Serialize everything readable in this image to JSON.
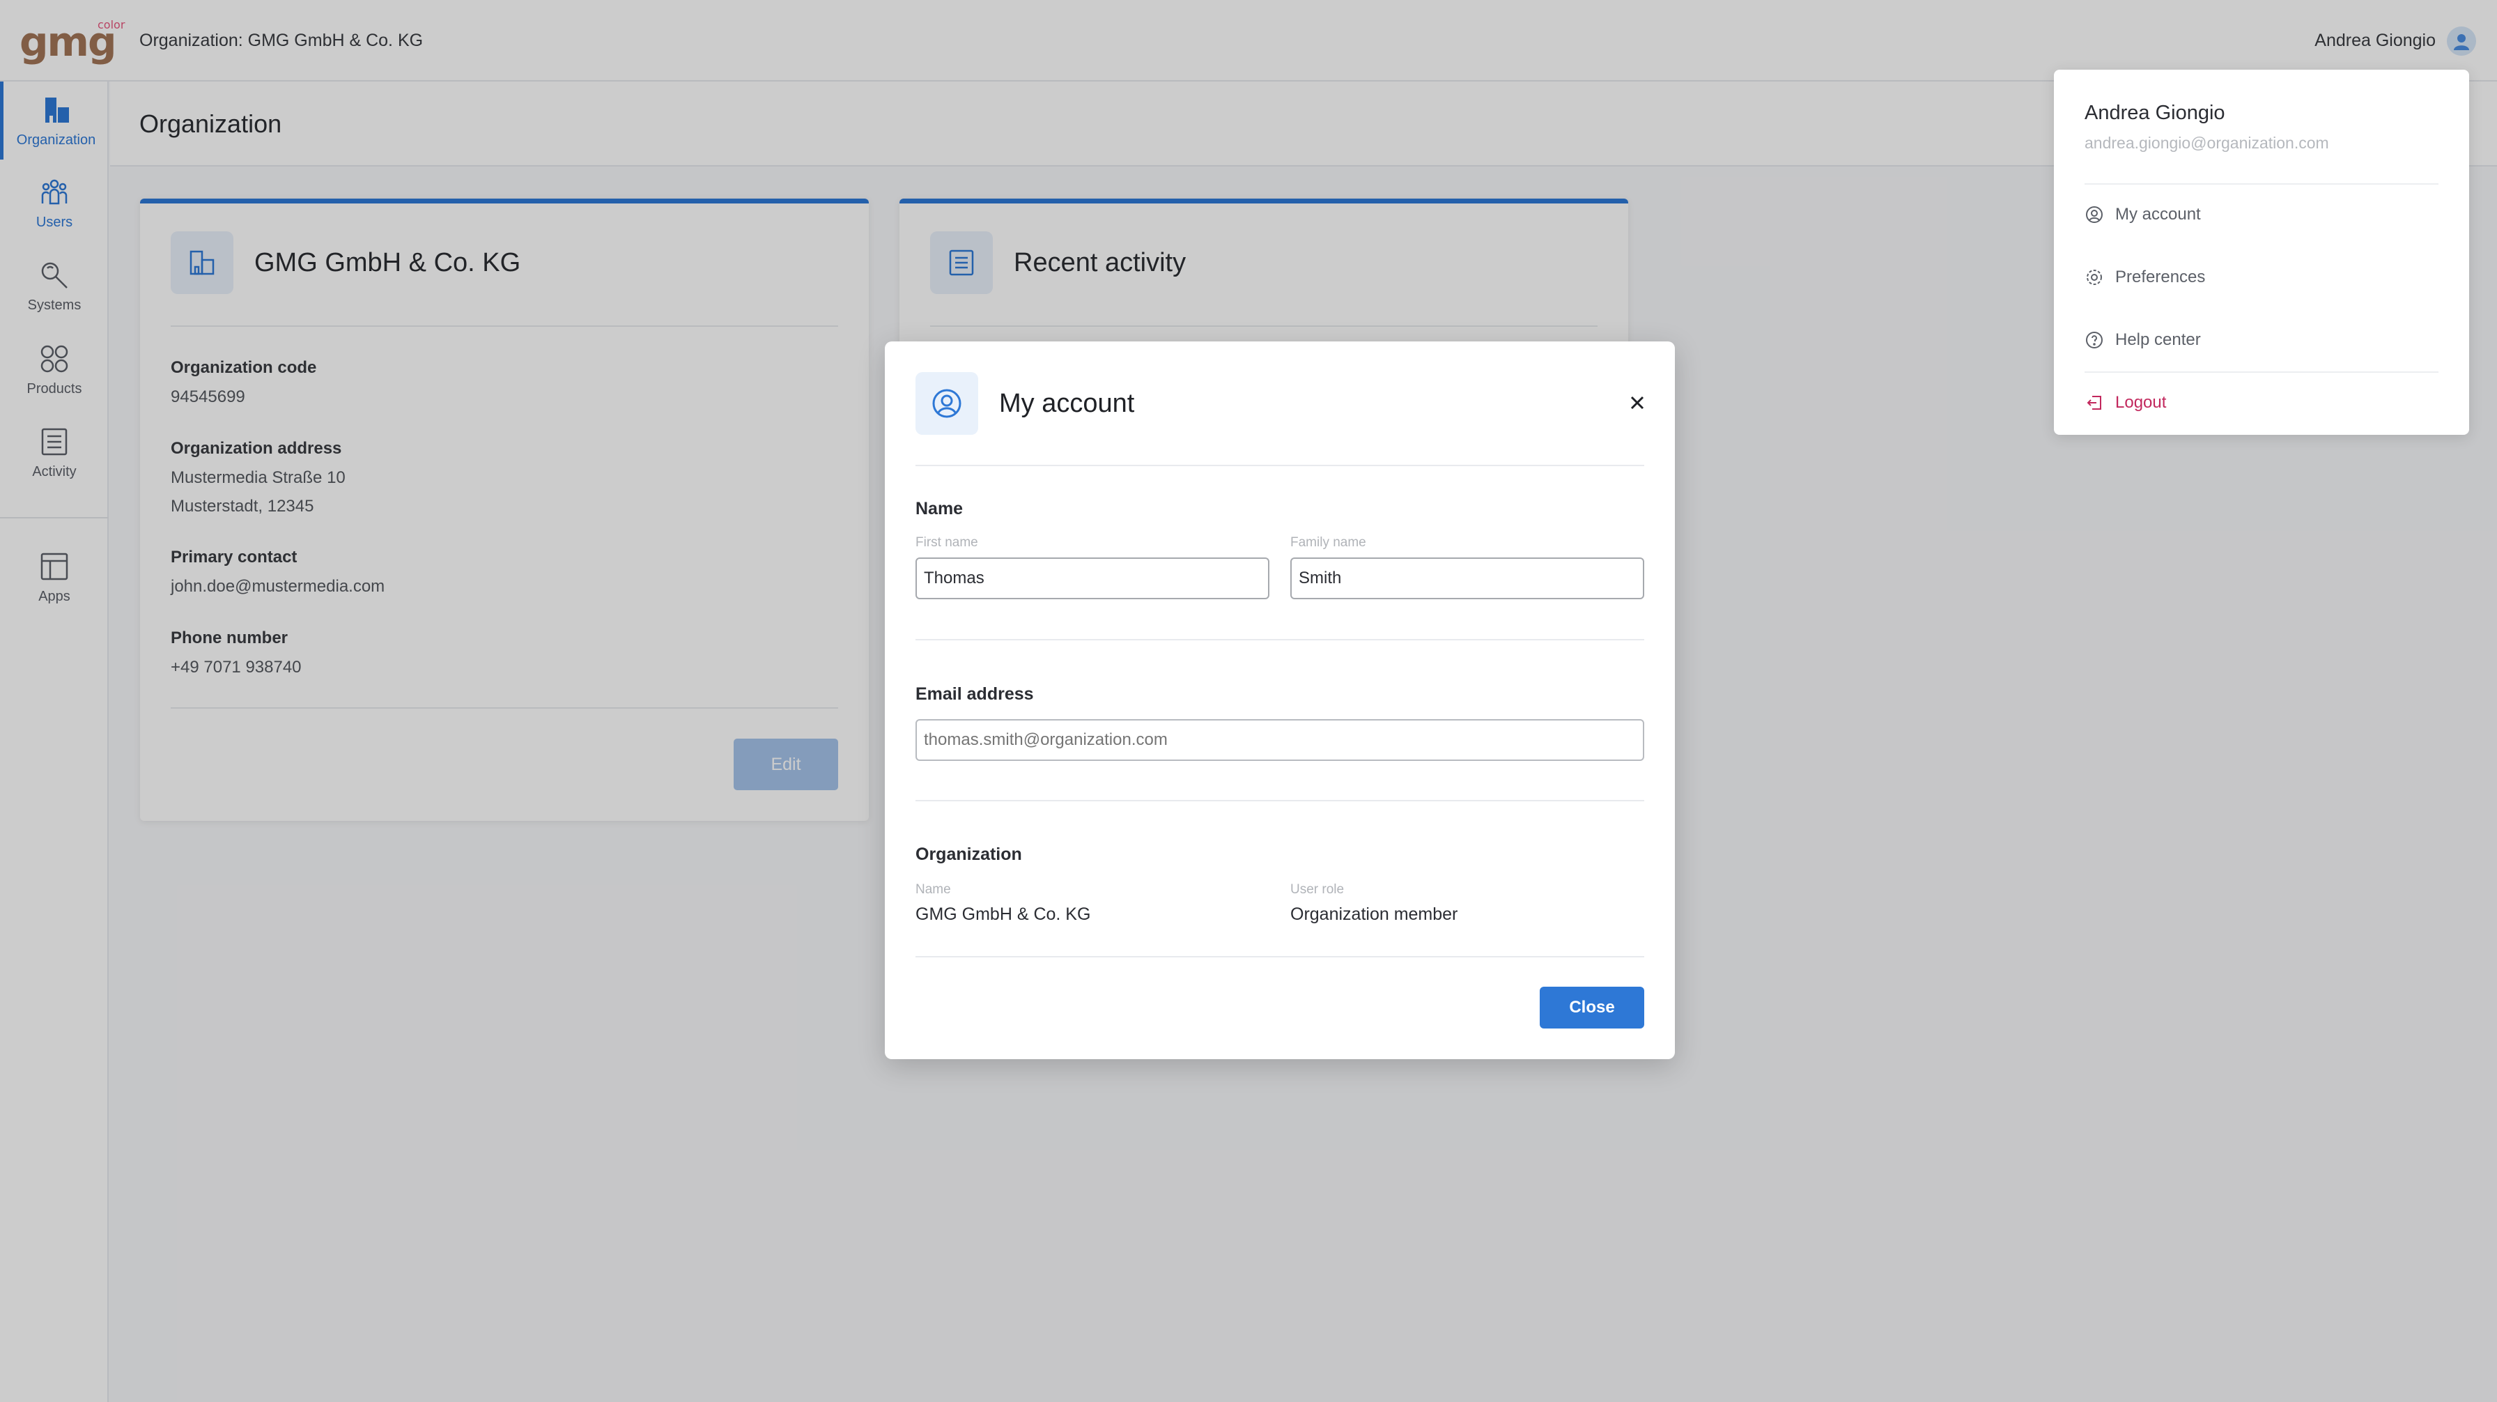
{
  "header": {
    "logo_text": "gmg",
    "logo_sup": "color",
    "org_label": "Organization: GMG GmbH & Co. KG",
    "user_name": "Andrea Giongio"
  },
  "sidebar": {
    "items": [
      {
        "label": "Organization",
        "icon": "organization-icon",
        "active": true
      },
      {
        "label": "Users",
        "icon": "users-icon",
        "active": false
      },
      {
        "label": "Systems",
        "icon": "systems-icon",
        "active": false
      },
      {
        "label": "Products",
        "icon": "products-icon",
        "active": false
      },
      {
        "label": "Activity",
        "icon": "activity-icon",
        "active": false
      },
      {
        "label": "Apps",
        "icon": "apps-icon",
        "active": false
      }
    ]
  },
  "page": {
    "title": "Organization"
  },
  "org_card": {
    "title": "GMG GmbH & Co. KG",
    "code_label": "Organization code",
    "code_value": "94545699",
    "address_label": "Organization address",
    "address_line1": "Mustermedia Straße 10",
    "address_line2": "Musterstadt, 12345",
    "contact_label": "Primary contact",
    "contact_value": "john.doe@mustermedia.com",
    "phone_label": "Phone number",
    "phone_value": "+49 7071 938740",
    "edit_label": "Edit"
  },
  "activity_card": {
    "title": "Recent activity"
  },
  "user_menu": {
    "name": "Andrea Giongio",
    "email": "andrea.giongio@organization.com",
    "items": [
      {
        "label": "My account",
        "icon": "account-icon"
      },
      {
        "label": "Preferences",
        "icon": "gear-icon"
      },
      {
        "label": "Help center",
        "icon": "help-icon"
      }
    ],
    "logout_label": "Logout"
  },
  "modal": {
    "title": "My account",
    "name_section": "Name",
    "first_name_label": "First name",
    "first_name_value": "Thomas",
    "family_name_label": "Family name",
    "family_name_value": "Smith",
    "email_section": "Email address",
    "email_placeholder": "thomas.smith@organization.com",
    "org_section": "Organization",
    "org_name_label": "Name",
    "org_name_value": "GMG GmbH & Co. KG",
    "role_label": "User role",
    "role_value": "Organization member",
    "close_label": "Close"
  },
  "colors": {
    "accent": "#2e78d6",
    "logo": "#a27557",
    "logout": "#c2285d"
  }
}
